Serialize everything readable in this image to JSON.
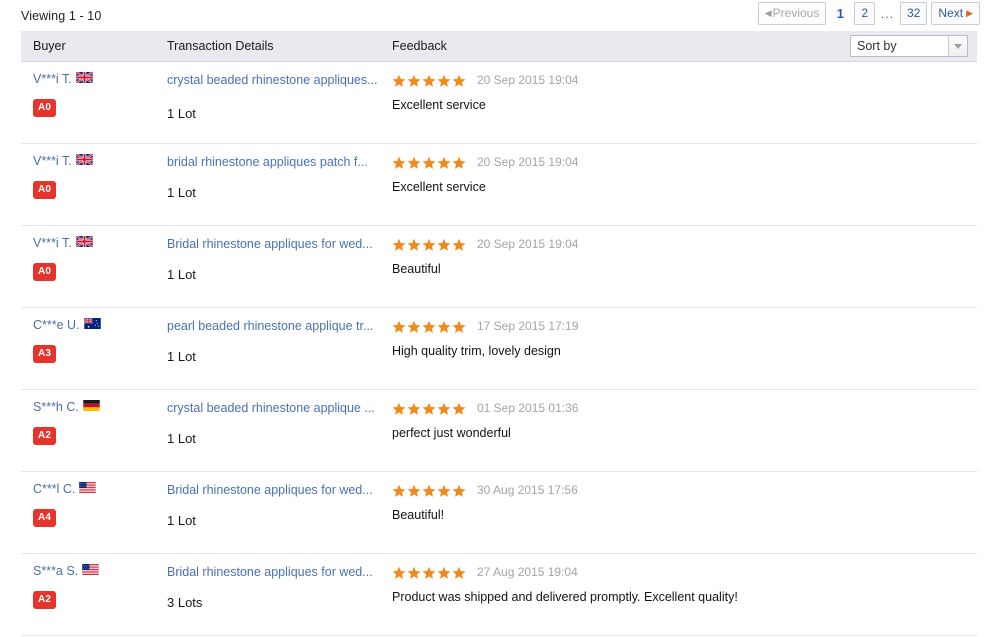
{
  "header": {
    "viewing_text": "Viewing 1 - 10",
    "pagination": {
      "previous_label": "Previous",
      "next_label": "Next",
      "pages": [
        "1",
        "2",
        "...",
        "32"
      ],
      "current_page": "1",
      "link_color": "#2e5c9e"
    }
  },
  "table": {
    "columns": {
      "buyer": "Buyer",
      "transaction_details": "Transaction Details",
      "feedback": "Feedback"
    },
    "sort": {
      "label": "Sort by",
      "icon": "chevron-down-icon"
    },
    "badge_color": "#e4342b",
    "star_color": "#f08a1c",
    "rows": [
      {
        "buyer_name": "V***i T.",
        "flag": "gb",
        "badge": "A0",
        "title": "crystal beaded rhinestone appliques...",
        "quantity": "1 Lot",
        "stars": 5,
        "date": "20 Sep 2015 19:04",
        "comment": "Excellent service"
      },
      {
        "buyer_name": "V***i T.",
        "flag": "gb",
        "badge": "A0",
        "title": "bridal rhinestone appliques patch f...",
        "quantity": "1 Lot",
        "stars": 5,
        "date": "20 Sep 2015 19:04",
        "comment": "Excellent service"
      },
      {
        "buyer_name": "V***i T.",
        "flag": "gb",
        "badge": "A0",
        "title": "Bridal rhinestone appliques for wed...",
        "quantity": "1 Lot",
        "stars": 5,
        "date": "20 Sep 2015 19:04",
        "comment": "Beautiful"
      },
      {
        "buyer_name": "C***e U.",
        "flag": "au",
        "badge": "A3",
        "title": "pearl beaded rhinestone applique tr...",
        "quantity": "1 Lot",
        "stars": 5,
        "date": "17 Sep 2015 17:19",
        "comment": "High quality trim, lovely design"
      },
      {
        "buyer_name": "S***h C.",
        "flag": "de",
        "badge": "A2",
        "title": "crystal beaded rhinestone applique ...",
        "quantity": "1 Lot",
        "stars": 5,
        "date": "01 Sep 2015 01:36",
        "comment": "perfect just wonderful"
      },
      {
        "buyer_name": "C***l C.",
        "flag": "us",
        "badge": "A4",
        "title": "Bridal rhinestone appliques for wed...",
        "quantity": "1 Lot",
        "stars": 5,
        "date": "30 Aug 2015 17:56",
        "comment": "Beautiful!"
      },
      {
        "buyer_name": "S***a S.",
        "flag": "us",
        "badge": "A2",
        "title": "Bridal rhinestone appliques for wed...",
        "quantity": "3 Lots",
        "stars": 5,
        "date": "27 Aug 2015 19:04",
        "comment": "Product was shipped and delivered promptly. Excellent quality!"
      }
    ]
  }
}
